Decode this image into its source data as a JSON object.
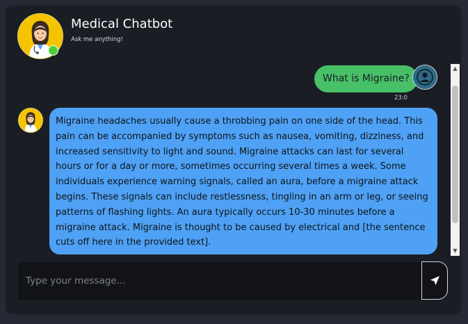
{
  "header": {
    "title": "Medical Chatbot",
    "subtitle": "Ask me anything!",
    "avatar_icon": "doctor-avatar-icon",
    "status": "online",
    "status_color": "#4cd137"
  },
  "messages": [
    {
      "sender": "user",
      "text": "What is Migraine?",
      "time": "23:0",
      "bubble_color": "#47c067",
      "avatar_icon": "user-avatar-icon"
    },
    {
      "sender": "bot",
      "text": "Migraine headaches usually cause a throbbing pain on one side of the head. This pain can be accompanied by symptoms such as nausea, vomiting, dizziness, and increased sensitivity to light and sound. Migraine attacks can last for several hours or for a day or more, sometimes occurring several times a week. Some individuals experience warning signals, called an aura, before a migraine attack begins. These signals can include restlessness, tingling in an arm or leg, or seeing patterns of flashing lights. An aura typically occurs 10-30 minutes before a migraine attack. Migraine is thought to be caused by electrical and [the sentence cuts off here in the provided text].",
      "bubble_color": "#4ea1f5",
      "avatar_icon": "doctor-avatar-icon"
    }
  ],
  "composer": {
    "placeholder": "Type your message...",
    "value": "",
    "send_icon": "send-icon"
  },
  "colors": {
    "background": "#262833",
    "card": "#1b1d24",
    "input": "#121317"
  }
}
